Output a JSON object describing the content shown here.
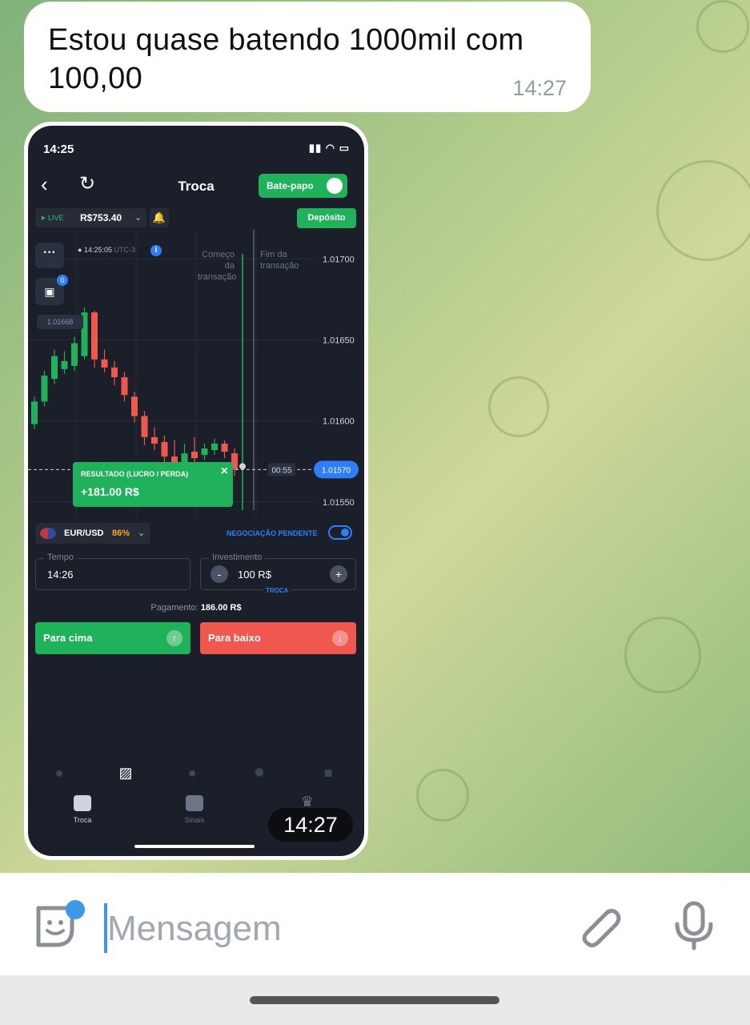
{
  "message": {
    "text": "Estou quase batendo 1000mil com 100,00",
    "time": "14:27"
  },
  "image_message": {
    "time": "14:27",
    "screenshot": {
      "status_time": "14:25",
      "nav_title": "Troca",
      "chat_button": "Bate-papo",
      "account_mode": "LIVE",
      "balance": "R$753.40",
      "deposit_button": "Depósito",
      "timestamp": "14:25:05",
      "timezone": "UTC-3",
      "bag_badge": "0",
      "price_tag": "1.01668",
      "label_start": "Começo da transação",
      "label_end": "Fim da transação",
      "countdown": "00:55",
      "current_price": "1.01570",
      "result_title": "RESULTADO (LUCRO / PERDA)",
      "result_value": "+181.00 R$",
      "pair": "EUR/USD",
      "pair_percent": "86%",
      "pending_label": "NEGOCIAÇÃO PENDENTE",
      "time_label": "Tempo",
      "time_value": "14:26",
      "investment_label": "Investimento",
      "investment_value": "100 R$",
      "trade_label": "TROCA",
      "payout_label": "Pagamento:",
      "payout_value": "186.00 R$",
      "up_button": "Para cima",
      "down_button": "Para baixo",
      "bottom_nav": [
        "Troca",
        "Sinais"
      ],
      "colors": {
        "green": "#1fb25a",
        "red": "#f0584f",
        "blue": "#2d7ff9",
        "bg": "#1b1f29"
      }
    }
  },
  "chart_data": {
    "type": "candlestick",
    "y_ticks": [
      "1.01700",
      "1.01650",
      "1.01600",
      "1.01550"
    ],
    "ylim": [
      1.0154,
      1.01718
    ],
    "current_price": 1.0157,
    "candles": [
      {
        "o": 1.01598,
        "c": 1.01612,
        "h": 1.01615,
        "l": 1.01595
      },
      {
        "o": 1.01612,
        "c": 1.01628,
        "h": 1.01631,
        "l": 1.01609
      },
      {
        "o": 1.01626,
        "c": 1.0164,
        "h": 1.01644,
        "l": 1.01623
      },
      {
        "o": 1.01632,
        "c": 1.01637,
        "h": 1.01643,
        "l": 1.01629
      },
      {
        "o": 1.01634,
        "c": 1.01648,
        "h": 1.01652,
        "l": 1.01631
      },
      {
        "o": 1.0164,
        "c": 1.01667,
        "h": 1.0167,
        "l": 1.01638
      },
      {
        "o": 1.01667,
        "c": 1.01638,
        "h": 1.01668,
        "l": 1.01633
      },
      {
        "o": 1.01638,
        "c": 1.01633,
        "h": 1.01644,
        "l": 1.0163
      },
      {
        "o": 1.01633,
        "c": 1.01627,
        "h": 1.01637,
        "l": 1.01622
      },
      {
        "o": 1.01627,
        "c": 1.01616,
        "h": 1.0163,
        "l": 1.01612
      },
      {
        "o": 1.01615,
        "c": 1.01603,
        "h": 1.01618,
        "l": 1.01599
      },
      {
        "o": 1.01603,
        "c": 1.0159,
        "h": 1.01606,
        "l": 1.01585
      },
      {
        "o": 1.0159,
        "c": 1.01586,
        "h": 1.01596,
        "l": 1.01582
      },
      {
        "o": 1.01587,
        "c": 1.01578,
        "h": 1.01591,
        "l": 1.01574
      },
      {
        "o": 1.01578,
        "c": 1.01572,
        "h": 1.01588,
        "l": 1.01569
      },
      {
        "o": 1.01572,
        "c": 1.0158,
        "h": 1.01586,
        "l": 1.01569
      },
      {
        "o": 1.01581,
        "c": 1.01577,
        "h": 1.0159,
        "l": 1.01574
      },
      {
        "o": 1.01579,
        "c": 1.01583,
        "h": 1.01586,
        "l": 1.01576
      },
      {
        "o": 1.01582,
        "c": 1.01586,
        "h": 1.01589,
        "l": 1.01579
      },
      {
        "o": 1.01586,
        "c": 1.01581,
        "h": 1.01588,
        "l": 1.01577
      },
      {
        "o": 1.0158,
        "c": 1.0157,
        "h": 1.01583,
        "l": 1.01566
      }
    ]
  },
  "input_bar": {
    "placeholder": "Mensagem",
    "icons": [
      "sticker-icon",
      "paperclip-icon",
      "microphone-icon"
    ]
  }
}
